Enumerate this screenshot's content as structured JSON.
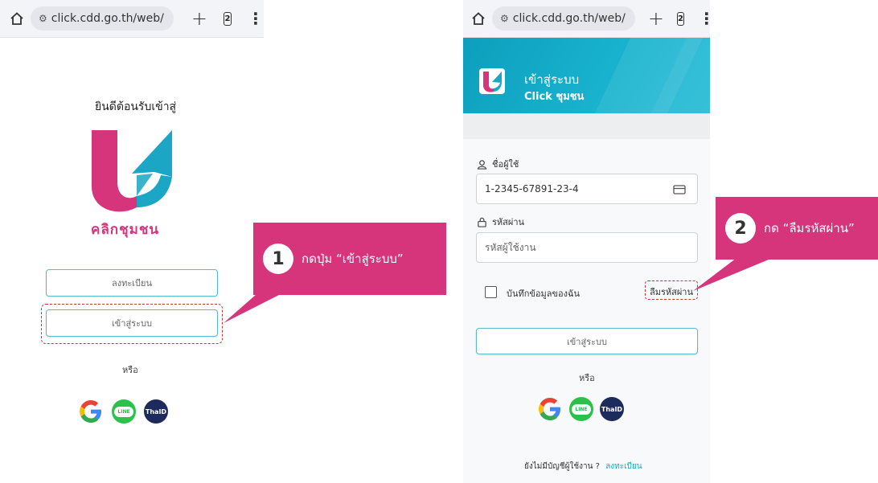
{
  "browser": {
    "url": "click.cdd.go.th/web/",
    "tab_count": "2"
  },
  "left": {
    "welcome": "ยินดีต้อนรับเข้าสู่",
    "logo_text": "คลิกชุมชน",
    "register_button": "ลงทะเบียน",
    "login_button": "เข้าสู่ระบบ",
    "or_text": "หรือ"
  },
  "callout1": {
    "number": "1",
    "text": "กดปุ่ม “เข้าสู่ระบบ”"
  },
  "right": {
    "header_title": "เข้าสู่ระบบ",
    "header_subtitle": "Click ชุมชน",
    "username_label": "ชื่อผู้ใช้",
    "username_value": "1-2345-67891-23-4",
    "password_label": "รหัสผ่าน",
    "password_placeholder": "รหัสผู้ใช้งาน",
    "remember_label": "บันทึกข้อมูลของฉัน",
    "forgot_link": "ลืมรหัสผ่าน",
    "login_button": "เข้าสู่ระบบ",
    "or_text": "หรือ",
    "no_account_text": "ยังไม่มีบัญชีผู้ใช้งาน ?",
    "register_link": "ลงทะเบียน"
  },
  "callout2": {
    "number": "2",
    "text": "กด “ลืมรหัสผ่าน”"
  },
  "social": {
    "google": "G",
    "line": "LINE",
    "thaid": "ThaID"
  },
  "colors": {
    "brand_pink": "#d6357c",
    "brand_teal": "#1aa6c4",
    "callout": "#d6357c",
    "highlight_dash": "#cc3333"
  }
}
